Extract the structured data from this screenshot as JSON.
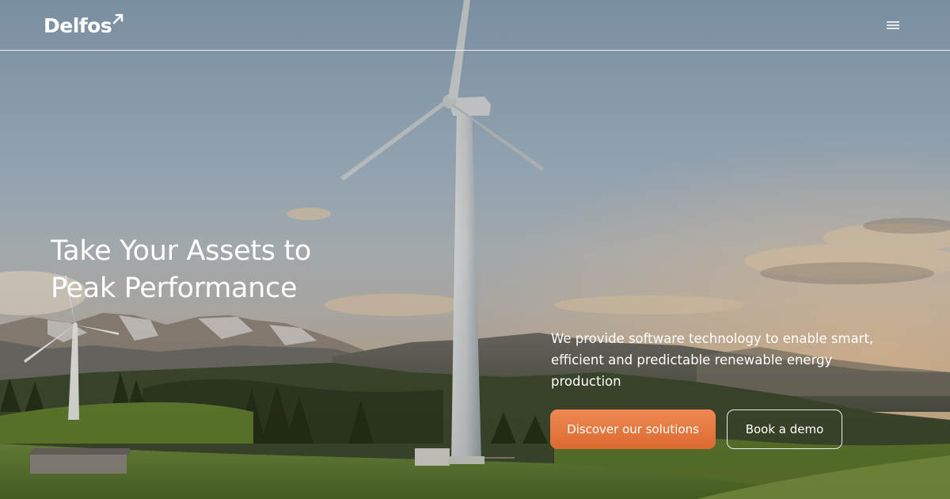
{
  "brand": {
    "name": "Delfos",
    "accent_color": "#e5763f"
  },
  "header": {
    "menu_icon": "hamburger-menu-icon"
  },
  "hero": {
    "headline_lines": [
      "Take Your Assets to",
      "Peak Performance"
    ],
    "tagline_lines": [
      "We provide software technology to enable smart,",
      "efficient and predictable renewable energy",
      "production"
    ],
    "primary_cta": "Discover our solutions",
    "secondary_cta": "Book a demo",
    "background": "wind-turbine-landscape-image"
  }
}
